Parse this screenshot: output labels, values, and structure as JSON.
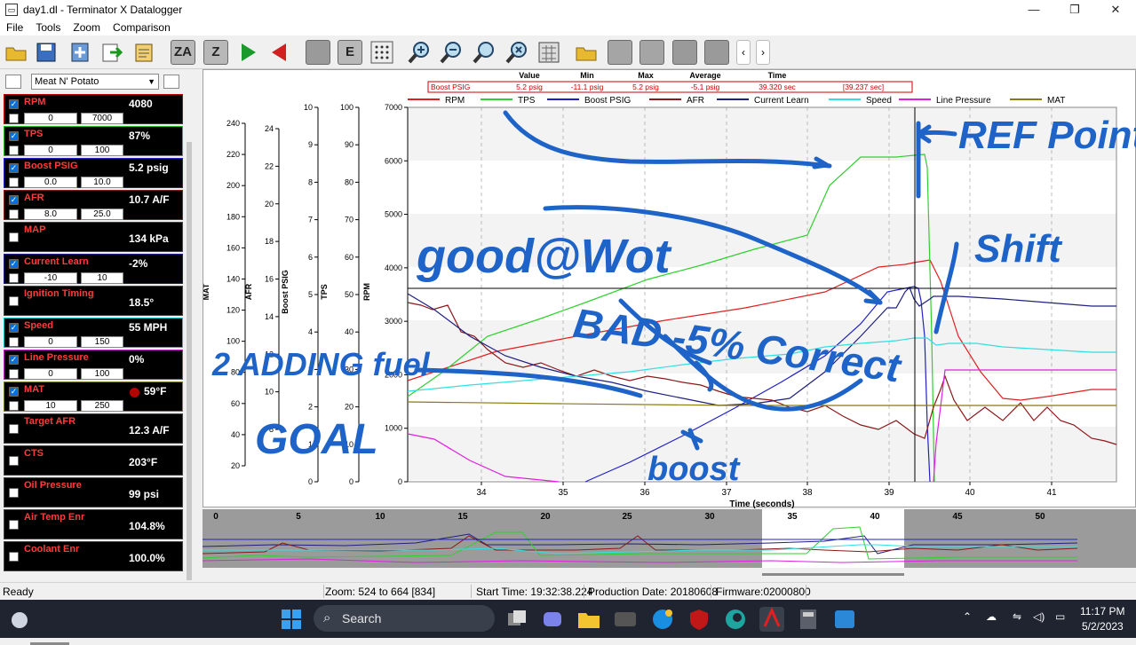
{
  "window": {
    "title": "day1.dl - Terminator X Datalogger",
    "minimize": "—",
    "maximize": "❐",
    "close": "✕"
  },
  "menu": [
    "File",
    "Tools",
    "Zoom",
    "Comparison"
  ],
  "toolbar": {
    "zoom_all_label": "ZA",
    "zoom_label": "Z",
    "e_label": "E",
    "prev_label": "‹",
    "next_label": "›"
  },
  "left_panel": {
    "preset": "Meat N' Potato",
    "channels": [
      {
        "name": "RPM",
        "value": "4080",
        "min": "0",
        "max": "7000",
        "border": "#c00000"
      },
      {
        "name": "TPS",
        "value": "87%",
        "min": "0",
        "max": "100",
        "border": "#20c020"
      },
      {
        "name": "Boost PSIG",
        "value": "5.2 psig",
        "min": "0.0",
        "max": "10.0",
        "border": "#2020c0"
      },
      {
        "name": "AFR",
        "value": "10.7 A/F",
        "min": "8.0",
        "max": "25.0",
        "border": "#802020"
      },
      {
        "name": "MAP",
        "value": "134 kPa"
      },
      {
        "name": "Current Learn",
        "value": "-2%",
        "min": "-10",
        "max": "10",
        "border": "#202080"
      },
      {
        "name": "Ignition Timing",
        "value": "18.5°"
      },
      {
        "name": "Speed",
        "value": "55 MPH",
        "min": "0",
        "max": "150",
        "border": "#00c8c8"
      },
      {
        "name": "Line Pressure",
        "value": "0%",
        "min": "0",
        "max": "100",
        "border": "#c020c0"
      },
      {
        "name": "MAT",
        "value": "59°F",
        "min": "10",
        "max": "250",
        "border": "#808020"
      },
      {
        "name": "Target AFR",
        "value": "12.3 A/F"
      },
      {
        "name": "CTS",
        "value": "203°F"
      },
      {
        "name": "Oil Pressure",
        "value": "99 psi"
      },
      {
        "name": "Air Temp Enr",
        "value": "104.8%"
      },
      {
        "name": "Coolant Enr",
        "value": "100.0%"
      }
    ]
  },
  "cursor_table": {
    "headers": [
      "Value",
      "Min",
      "Max",
      "Average",
      "Time"
    ],
    "row": {
      "channel": "Boost PSIG",
      "value": "5.2 psig",
      "min": "-11.1 psig",
      "max": "5.2 psig",
      "average": "-5.1 psig",
      "time": "39.320 sec",
      "delta": "[39.237 sec]"
    }
  },
  "legend": [
    {
      "name": "RPM",
      "color": "#e02020"
    },
    {
      "name": "TPS",
      "color": "#30d030"
    },
    {
      "name": "Boost PSIG",
      "color": "#2020c8"
    },
    {
      "name": "AFR",
      "color": "#8b1a1a"
    },
    {
      "name": "Current Learn",
      "color": "#202080"
    },
    {
      "name": "Speed",
      "color": "#30e0e0"
    },
    {
      "name": "Line Pressure",
      "color": "#e020e0"
    },
    {
      "name": "MAT",
      "color": "#8a7a10"
    }
  ],
  "axes": {
    "mat": {
      "label": "MAT",
      "ticks": [
        "240",
        "220",
        "200",
        "180",
        "160",
        "140",
        "120",
        "100",
        "80",
        "60",
        "40",
        "20"
      ]
    },
    "afr": {
      "label": "AFR",
      "ticks": [
        "24",
        "22",
        "20",
        "18",
        "16",
        "14",
        "12",
        "10",
        "8"
      ]
    },
    "boost": {
      "label": "Boost PSIG",
      "ticks": [
        "10",
        "9",
        "8",
        "7",
        "6",
        "5",
        "4",
        "3",
        "2",
        "1",
        "0"
      ]
    },
    "tps": {
      "label": "TPS",
      "ticks": [
        "100",
        "90",
        "80",
        "70",
        "60",
        "50",
        "40",
        "30",
        "20",
        "10",
        "0"
      ]
    },
    "rpm": {
      "label": "RPM",
      "ticks": [
        "7000",
        "6000",
        "5000",
        "4000",
        "3000",
        "2000",
        "1000",
        "0"
      ]
    },
    "time": {
      "label": "Time (seconds)",
      "ticks": [
        "34",
        "35",
        "36",
        "37",
        "38",
        "39",
        "40",
        "41"
      ]
    }
  },
  "overview": {
    "ticks": [
      "0",
      "5",
      "10",
      "15",
      "20",
      "25",
      "30",
      "35",
      "40",
      "45",
      "50"
    ]
  },
  "annotations": [
    "good@Wot",
    "REF Point",
    "Shift",
    "BAD -5% Correct",
    "2 ADDING fuel",
    "GOAL",
    "boost"
  ],
  "status": {
    "ready": "Ready",
    "zoom": "Zoom: 524 to 664 [834]",
    "start": "Start Time: 19:32:38.224",
    "production": "Production Date: 20180608",
    "firmware": "Firmware:02000800"
  },
  "taskbar": {
    "search": "Search",
    "time": "11:17 PM",
    "date": "5/2/2023"
  }
}
